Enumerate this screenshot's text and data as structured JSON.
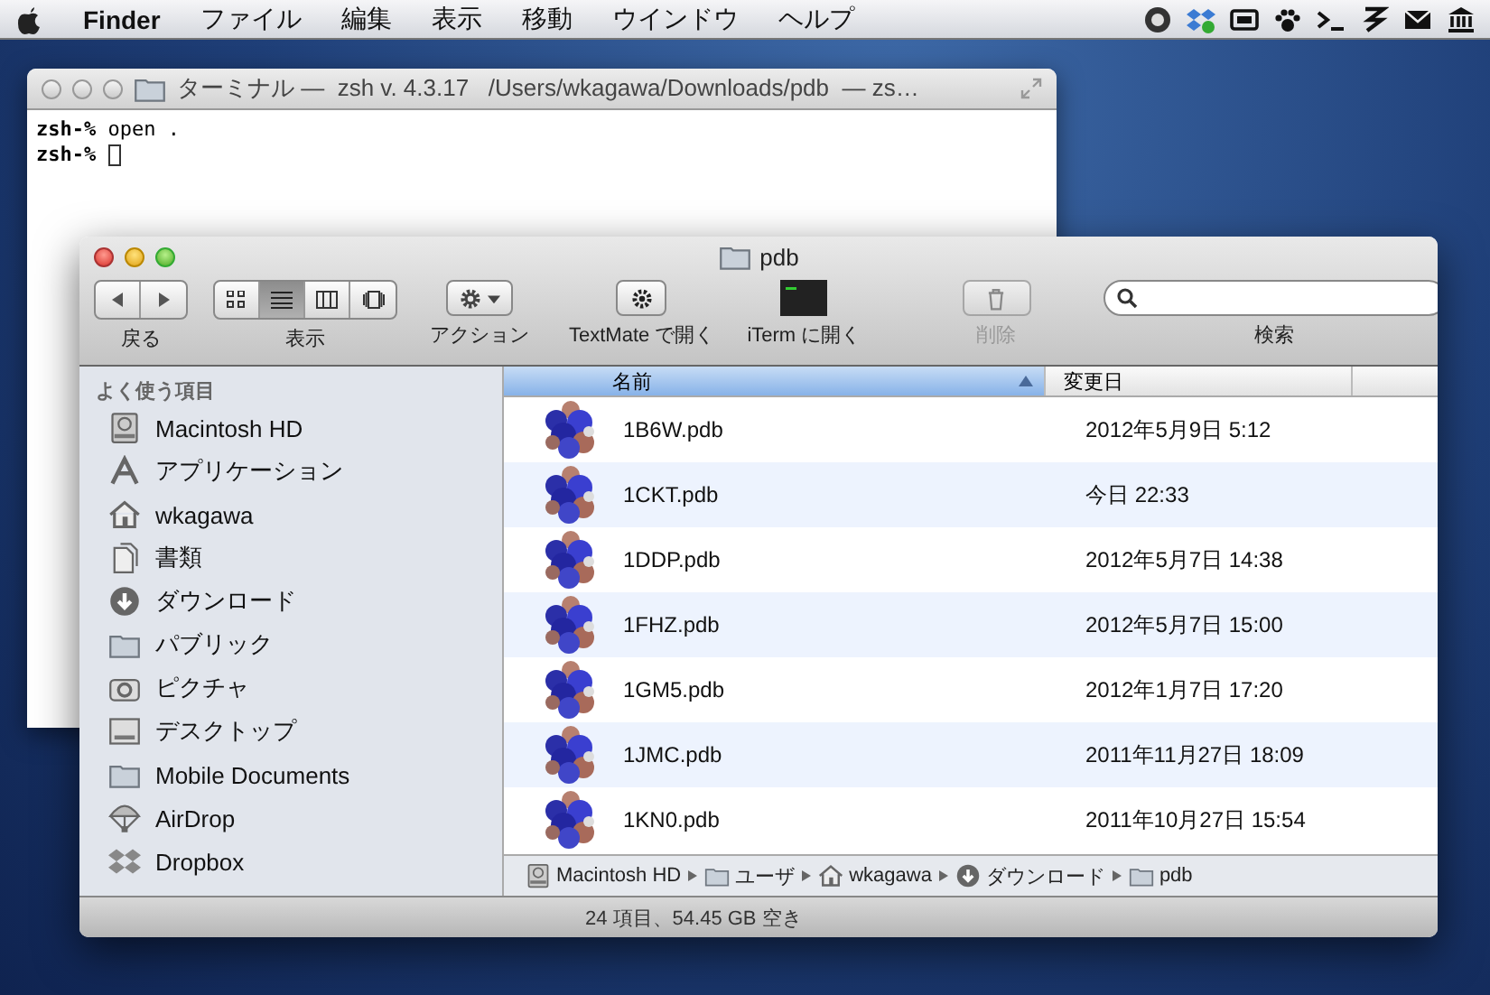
{
  "menubar": {
    "items": [
      {
        "label": "Finder",
        "kind": "app"
      },
      {
        "label": "ファイル",
        "kind": "menu"
      },
      {
        "label": "編集",
        "kind": "menu"
      },
      {
        "label": "表示",
        "kind": "menu"
      },
      {
        "label": "移動",
        "kind": "menu"
      },
      {
        "label": "ウインドウ",
        "kind": "menu"
      },
      {
        "label": "ヘルプ",
        "kind": "menu"
      }
    ]
  },
  "terminal": {
    "title": "ターミナル —  zsh v. 4.3.17   /Users/wkagawa/Downloads/pdb  — zs…",
    "lines": [
      "**zsh-%** open .",
      "**zsh-%** "
    ]
  },
  "finder": {
    "title": "pdb",
    "toolbar": [
      {
        "kind": "nav",
        "label": "戻る"
      },
      {
        "kind": "view",
        "label": "表示",
        "modes": [
          {
            "selected": false
          },
          {
            "selected": true
          },
          {
            "selected": false
          },
          {
            "selected": false
          }
        ]
      },
      {
        "kind": "action",
        "label": "アクション"
      },
      {
        "kind": "gear-button",
        "label": "TextMate で開く"
      },
      {
        "kind": "terminal-button",
        "label": "iTerm に開く"
      },
      {
        "kind": "trash-button",
        "label": "削除",
        "disabled": true
      },
      {
        "kind": "search",
        "label": "検索"
      }
    ],
    "sidebar": {
      "heading": "よく使う項目",
      "items": [
        "Macintosh HD",
        "アプリケーション",
        "wkagawa",
        "書類",
        "ダウンロード",
        "パブリック",
        "ピクチャ",
        "デスクトップ",
        "Mobile Documents",
        "AirDrop",
        "Dropbox"
      ]
    },
    "columns": [
      {
        "label": "名前",
        "sorted": true
      },
      {
        "label": "変更日",
        "sorted": false
      }
    ],
    "rows": [
      {
        "name": "1B6W.pdb",
        "date": "2012年5月9日 5:12"
      },
      {
        "name": "1CKT.pdb",
        "date": "今日 22:33"
      },
      {
        "name": "1DDP.pdb",
        "date": "2012年5月7日 14:38"
      },
      {
        "name": "1FHZ.pdb",
        "date": "2012年5月7日 15:00"
      },
      {
        "name": "1GM5.pdb",
        "date": "2012年1月7日 17:20"
      },
      {
        "name": "1JMC.pdb",
        "date": "2011年11月27日 18:09"
      },
      {
        "name": "1KN0.pdb",
        "date": "2011年10月27日 15:54"
      }
    ],
    "path": [
      "Macintosh HD",
      "ユーザ",
      "wkagawa",
      "ダウンロード",
      "pdb"
    ],
    "status": "24 項目、54.45 GB 空き"
  }
}
